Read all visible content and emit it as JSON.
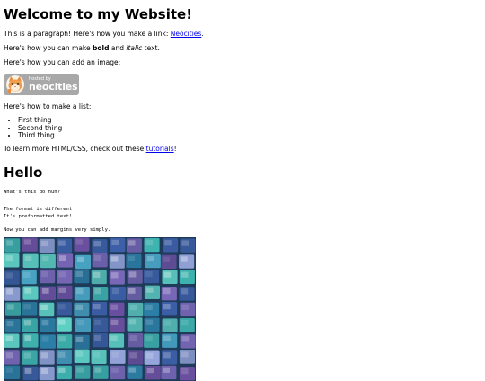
{
  "page": {
    "title": "Welcome to my Website!",
    "intro": {
      "text_before": "This is a paragraph! Here's how you make a link: ",
      "link_label": "Neocities",
      "text_after": "."
    },
    "bold_italic": {
      "text1": "Here's how you can make ",
      "bold": "bold",
      "text2": " and ",
      "italic": "italic",
      "text3": " text."
    },
    "image_intro": "Here's how you can add an image:",
    "badge": {
      "hosted_by": "hosted by",
      "brand": "neocities",
      "icon": "neocities-cat-icon"
    },
    "list_intro": "Here's how to make a list:",
    "list_items": [
      "First thing",
      "Second thing",
      "Third thing"
    ],
    "learn_more": {
      "text_before": "To learn more HTML/CSS, check out these ",
      "link_label": "tutorials",
      "text_after": "!"
    },
    "hello_heading": "Hello",
    "code_question": "What's this do huh?",
    "preformatted": "The format is different\nIt's preformatted text!",
    "margins_text": "Now you can add margins very simply.",
    "tile_image": "mosaic-tile-image"
  },
  "colors": {
    "link": "#0000ee",
    "badge_bg": "#a8a8a8",
    "tile_teal": "#3fb6b0",
    "tile_blue": "#3d5fa8",
    "tile_purple": "#7a67b8"
  }
}
